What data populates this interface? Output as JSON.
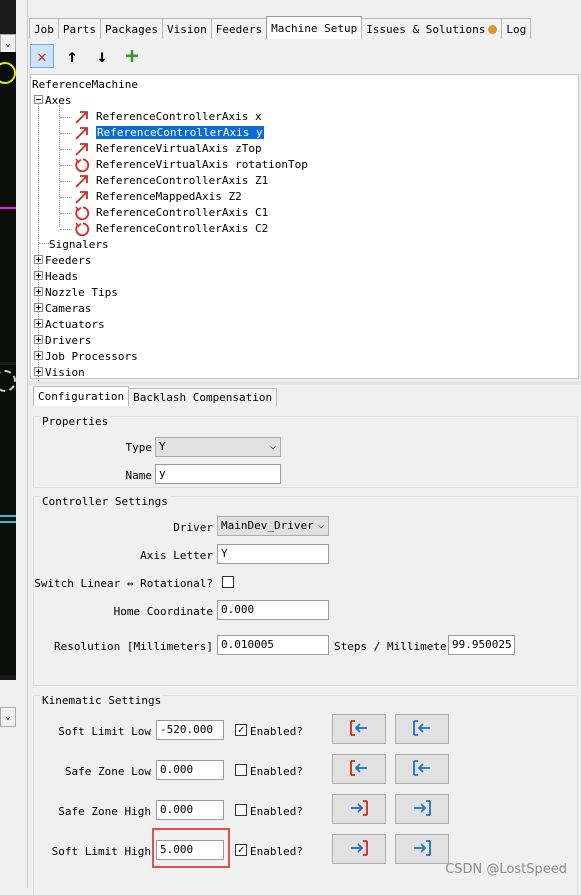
{
  "tabs": [
    "Job",
    "Parts",
    "Packages",
    "Vision",
    "Feeders",
    "Machine Setup",
    "Issues & Solutions",
    "Log"
  ],
  "active_tab": "Machine Setup",
  "toolbar": {
    "delete_icon": "✕",
    "up_icon": "↑",
    "down_icon": "↓",
    "add_icon": "+"
  },
  "tree": {
    "root": "ReferenceMachine",
    "axes_label": "Axes",
    "axes": [
      {
        "label": "ReferenceControllerAxis x",
        "icon": "linear-axis-icon"
      },
      {
        "label": "ReferenceControllerAxis y",
        "icon": "linear-axis-icon",
        "selected": true
      },
      {
        "label": "ReferenceVirtualAxis zTop",
        "icon": "linear-axis-icon"
      },
      {
        "label": "ReferenceVirtualAxis rotationTop",
        "icon": "rotation-axis-icon"
      },
      {
        "label": "ReferenceControllerAxis Z1",
        "icon": "linear-axis-icon"
      },
      {
        "label": "ReferenceMappedAxis Z2",
        "icon": "linear-axis-icon"
      },
      {
        "label": "ReferenceControllerAxis C1",
        "icon": "rotation-axis-icon"
      },
      {
        "label": "ReferenceControllerAxis C2",
        "icon": "rotation-axis-icon"
      }
    ],
    "signalers": "Signalers",
    "groups": [
      "Feeders",
      "Heads",
      "Nozzle Tips",
      "Cameras",
      "Actuators",
      "Drivers",
      "Job Processors",
      "Vision"
    ]
  },
  "subtabs": [
    "Configuration",
    "Backlash Compensation"
  ],
  "properties": {
    "legend": "Properties",
    "type_label": "Type",
    "type_value": "Y",
    "name_label": "Name",
    "name_value": "y"
  },
  "controller": {
    "legend": "Controller Settings",
    "driver_label": "Driver",
    "driver_value": "MainDev_Driver",
    "letter_label": "Axis Letter",
    "letter_value": "Y",
    "switch_label": "Switch Linear ↔ Rotational?",
    "home_label": "Home Coordinate",
    "home_value": "0.000",
    "resolution_label": "Resolution [Millimeters]",
    "resolution_value": "0.010005",
    "steps_label": "Steps / Millimeter",
    "steps_value": "99.950025"
  },
  "kinematic": {
    "legend": "Kinematic Settings",
    "enabled_label": "Enabled?",
    "rows": [
      {
        "label": "Soft Limit Low",
        "value": "-520.000",
        "enabled": true,
        "checkmark": "✓"
      },
      {
        "label": "Safe Zone Low",
        "value": "0.000",
        "enabled": false,
        "checkmark": ""
      },
      {
        "label": "Safe Zone High",
        "value": "0.000",
        "enabled": false,
        "checkmark": ""
      },
      {
        "label": "Soft Limit High",
        "value": "5.000",
        "enabled": true,
        "checkmark": "✓"
      }
    ]
  },
  "left_strip": {
    "dropdown_arrow": "⌄"
  },
  "watermark": "CSDN @LostSpeed",
  "colors": {
    "selection": "#0a6cd6",
    "axis_icon": "#d42a1c",
    "capture_btn": "#2070c8",
    "highlight": "#e05050",
    "add_icon": "#3a9a2a"
  }
}
